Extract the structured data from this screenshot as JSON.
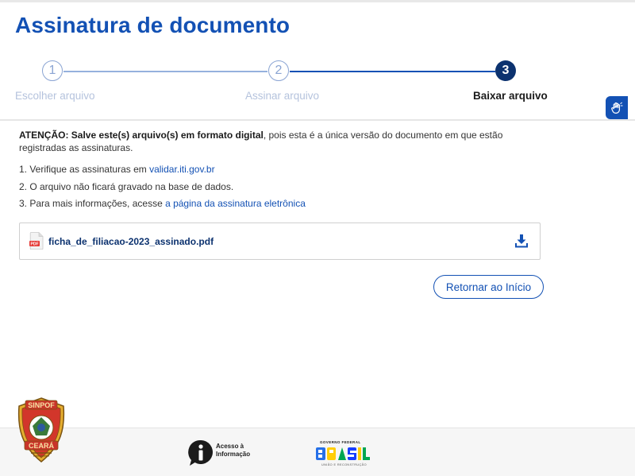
{
  "page": {
    "title": "Assinatura de documento"
  },
  "stepper": {
    "steps": [
      {
        "number": "1",
        "label": "Escolher arquivo",
        "state": "done"
      },
      {
        "number": "2",
        "label": "Assinar arquivo",
        "state": "done"
      },
      {
        "number": "3",
        "label": "Baixar arquivo",
        "state": "active"
      }
    ]
  },
  "notice": {
    "bold": "ATENÇÃO: Salve este(s) arquivo(s) em formato digital",
    "rest": ", pois esta é a única versão do documento em que estão registradas as assinaturas."
  },
  "instructions": {
    "item1_prefix": "1. Verifique as assinaturas em ",
    "item1_link": "validar.iti.gov.br",
    "item2": "2. O arquivo não ficará gravado na base de dados.",
    "item3_prefix": "3. Para mais informações, acesse ",
    "item3_link": "a página da assinatura eletrônica"
  },
  "file": {
    "name": "ficha_de_filiacao-2023_assinado.pdf",
    "icon": "pdf-file-icon",
    "badge": "PDF"
  },
  "actions": {
    "return_label": "Retornar ao Início"
  },
  "footer": {
    "sinpof_top": "SINPOF",
    "sinpof_bottom": "CEARÁ",
    "acesso_line1": "Acesso à",
    "acesso_line2": "Informação",
    "gov_top": "GOVERNO FEDERAL",
    "gov_bottom": "UNIÃO E RECONSTRUÇÃO"
  },
  "colors": {
    "primary": "#1351b4",
    "primary_dark": "#0c326f",
    "pdf_red": "#e53935"
  }
}
